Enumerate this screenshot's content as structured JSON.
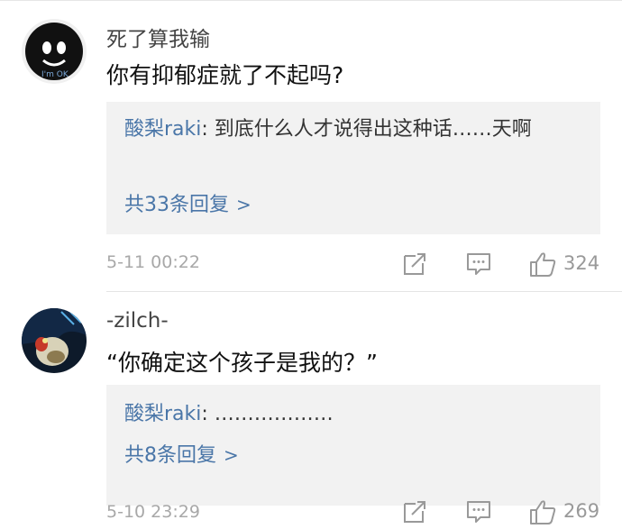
{
  "comments": [
    {
      "username": "死了算我输",
      "text": "你有抑郁症就了不起吗?",
      "avatar_text": "I'm OK",
      "reply_preview": {
        "user": "酸梨raki",
        "text": ": 到底什么人才说得出这种话……天啊"
      },
      "more_replies": "共33条回复",
      "timestamp": "5-11 00:22",
      "likes": "324"
    },
    {
      "username": "-zilch-",
      "text": "“你确定这个孩子是我的？”",
      "reply_preview": {
        "user": "酸梨raki",
        "text": ": ………………"
      },
      "more_replies": "共8条回复",
      "timestamp": "5-10 23:29",
      "likes": "269"
    }
  ],
  "icons": {
    "chevron": ">",
    "share": "share-icon",
    "reply": "comment-icon",
    "like": "thumbs-up-icon"
  },
  "colors": {
    "link": "#4a76a8",
    "reply_bg": "#f2f2f2",
    "meta": "#a8a8a8"
  }
}
